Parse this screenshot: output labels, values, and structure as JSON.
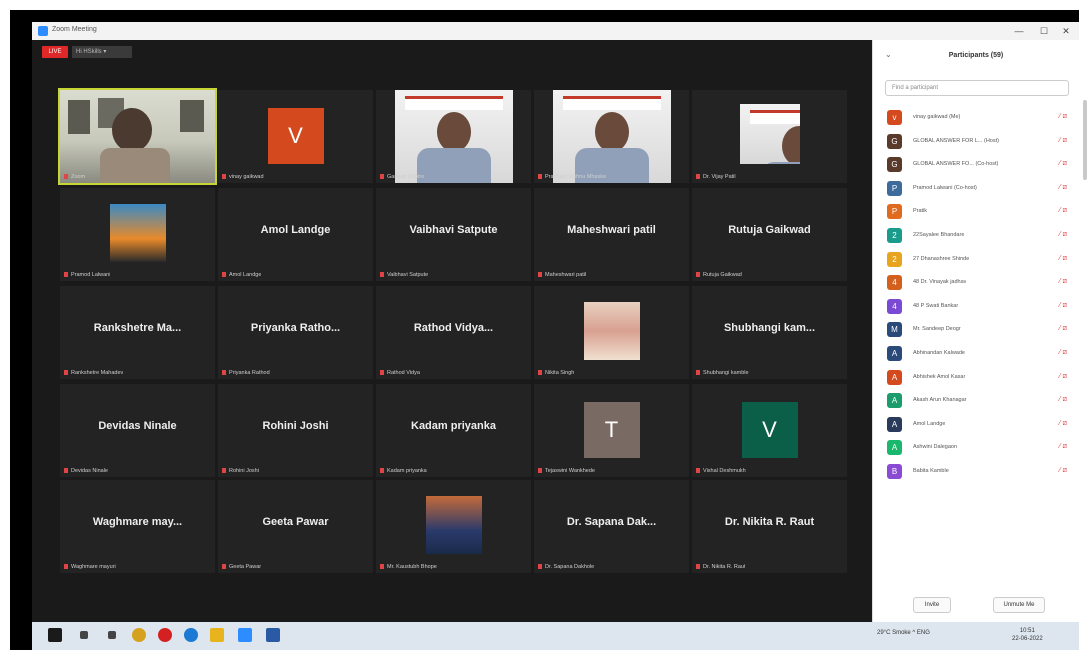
{
  "window": {
    "title": "Zoom Meeting",
    "controls": [
      "—",
      "☐",
      "✕"
    ]
  },
  "top_chips": {
    "live": "LIVE",
    "recording": "Hi HSkills ▾"
  },
  "gallery": {
    "tiles": [
      {
        "type": "video",
        "caption": "Zoom",
        "active": true
      },
      {
        "type": "avatar",
        "letter": "V",
        "color": "#d44a1e",
        "caption": "vinay gaikwad"
      },
      {
        "type": "video",
        "caption": "Ganesh Dhotre"
      },
      {
        "type": "video",
        "caption": "Prashant Vishnu Mhaske"
      },
      {
        "type": "video",
        "caption": "Dr. Vijay Patil"
      },
      {
        "type": "photo",
        "caption": "Pramod Lalwani"
      },
      {
        "type": "name",
        "name": "Amol Landge",
        "caption": "Amol Landge"
      },
      {
        "type": "name",
        "name": "Vaibhavi Satpute",
        "caption": "Vaibhavi Satpute"
      },
      {
        "type": "name",
        "name": "Maheshwari patil",
        "caption": "Maheshwari patil"
      },
      {
        "type": "name",
        "name": "Rutuja Gaikwad",
        "caption": "Rutuja Gaikwad"
      },
      {
        "type": "name",
        "name": "Rankshetre Ma...",
        "caption": "Rankshetre Mahadev"
      },
      {
        "type": "name",
        "name": "Priyanka Ratho...",
        "caption": "Priyanka Rathod"
      },
      {
        "type": "name",
        "name": "Rathod Vidya...",
        "caption": "Rathod Vidya"
      },
      {
        "type": "photo",
        "caption": "Nikita Singh"
      },
      {
        "type": "name",
        "name": "Shubhangi kam...",
        "caption": "Shubhangi kamble"
      },
      {
        "type": "name",
        "name": "Devidas Ninale",
        "caption": "Devidas Ninale"
      },
      {
        "type": "name",
        "name": "Rohini Joshi",
        "caption": "Rohini Joshi"
      },
      {
        "type": "name",
        "name": "Kadam priyanka",
        "caption": "Kadam priyanka"
      },
      {
        "type": "avatar",
        "letter": "T",
        "color": "#7a6a64",
        "caption": "Tejaswini Wankhede"
      },
      {
        "type": "avatar",
        "letter": "V",
        "color": "#0b5e47",
        "caption": "Vishal Deshmukh"
      },
      {
        "type": "name",
        "name": "Waghmare may...",
        "caption": "Waghmare mayuri"
      },
      {
        "type": "name",
        "name": "Geeta Pawar",
        "caption": "Geeta Pawar"
      },
      {
        "type": "photo",
        "caption": "Mr. Kaustubh Bhope"
      },
      {
        "type": "name",
        "name": "Dr. Sapana Dak...",
        "caption": "Dr. Sapana Dakhole"
      },
      {
        "type": "name",
        "name": "Dr. Nikita R. Raut",
        "caption": "Dr. Nikita R. Raut"
      }
    ]
  },
  "participants": {
    "title": "Participants (59)",
    "search_placeholder": "Find a participant",
    "items": [
      {
        "name": "vinay gaikwad (Me)",
        "color": "#d44a1e",
        "letter": "v"
      },
      {
        "name": "GLOBAL ANSWER FOR L... (Host)",
        "color": "#5a3a2a",
        "letter": "G"
      },
      {
        "name": "GLOBAL ANSWER FO... (Co-host)",
        "color": "#5a3a2a",
        "letter": "G"
      },
      {
        "name": "Pramod Lalwani (Co-host)",
        "color": "#3d6b9c",
        "letter": "P"
      },
      {
        "name": "Pratik",
        "color": "#e06a1e",
        "letter": "P"
      },
      {
        "name": "22Sayalee Bhandare",
        "color": "#1a9c8c",
        "letter": "2"
      },
      {
        "name": "27 Dhanashree Shinde",
        "color": "#e8a41e",
        "letter": "2"
      },
      {
        "name": "48 Dr. Vinayak jadhav",
        "color": "#d4601e",
        "letter": "4"
      },
      {
        "name": "48 P Swati Bankar",
        "color": "#7a4ad4",
        "letter": "4"
      },
      {
        "name": "Mr. Sandeep Deogr",
        "color": "#2a4a7a",
        "letter": "M"
      },
      {
        "name": "Abhinandan Kalwade",
        "color": "#2a4a7a",
        "letter": "A"
      },
      {
        "name": "Abhishek Amol Kasar",
        "color": "#d44a1e",
        "letter": "A"
      },
      {
        "name": "Akash Arun Khanagar",
        "color": "#1a9c6c",
        "letter": "A"
      },
      {
        "name": "Amol Landge",
        "color": "#2a3a5a",
        "letter": "A"
      },
      {
        "name": "Ashwini Dalegaon",
        "color": "#1ab86c",
        "letter": "A"
      },
      {
        "name": "Babita Kamble",
        "color": "#8a4ad4",
        "letter": "B"
      }
    ],
    "buttons": {
      "invite": "Invite",
      "unmute": "Unmute Me"
    }
  },
  "taskbar": {
    "icons": [
      {
        "name": "start",
        "color": "#1a1a1a"
      },
      {
        "name": "search",
        "color": "#444444"
      },
      {
        "name": "task-view",
        "color": "#444444"
      },
      {
        "name": "chrome",
        "color": "#d4a21e"
      },
      {
        "name": "opera",
        "color": "#d42020"
      },
      {
        "name": "edge",
        "color": "#1a7ad4"
      },
      {
        "name": "explorer",
        "color": "#e8b41e"
      },
      {
        "name": "zoom",
        "color": "#2d8cff"
      },
      {
        "name": "word",
        "color": "#2a5aa4"
      }
    ],
    "tray_text": "29°C  Smoke  ^  ENG",
    "time": "10:51",
    "date": "22-06-2022"
  }
}
